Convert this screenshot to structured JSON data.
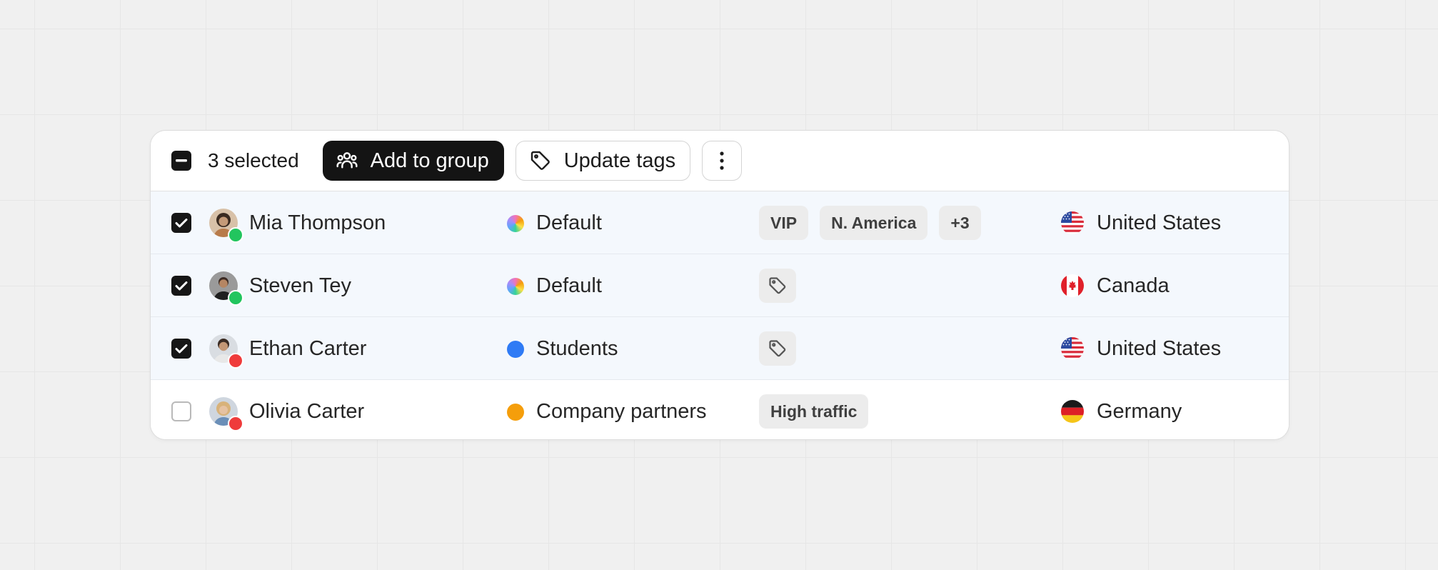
{
  "toolbar": {
    "selected_label": "3 selected",
    "add_to_group_label": "Add to group",
    "update_tags_label": "Update tags"
  },
  "rows": [
    {
      "checked": true,
      "name": "Mia Thompson",
      "status_color": "#22c55e",
      "group": "Default",
      "group_dot": "conic",
      "tags": [
        "VIP",
        "N. America",
        "+3"
      ],
      "country": "United States",
      "flag": "us"
    },
    {
      "checked": true,
      "name": "Steven Tey",
      "status_color": "#22c55e",
      "group": "Default",
      "group_dot": "conic",
      "tags": [],
      "country": "Canada",
      "flag": "ca"
    },
    {
      "checked": true,
      "name": "Ethan Carter",
      "status_color": "#ef3b3b",
      "group": "Students",
      "group_dot": "#2f7bf5",
      "tags": [],
      "country": "United States",
      "flag": "us"
    },
    {
      "checked": false,
      "name": "Olivia Carter",
      "status_color": "#ef3b3b",
      "group": "Company partners",
      "group_dot": "#f59e0b",
      "tags": [
        "High traffic"
      ],
      "country": "Germany",
      "flag": "de"
    }
  ],
  "icons": {
    "header_checkbox": "minus-icon",
    "add_to_group": "users-icon",
    "update_tags": "tag-icon",
    "more": "more-vertical-icon",
    "empty_tag": "tag-icon"
  }
}
